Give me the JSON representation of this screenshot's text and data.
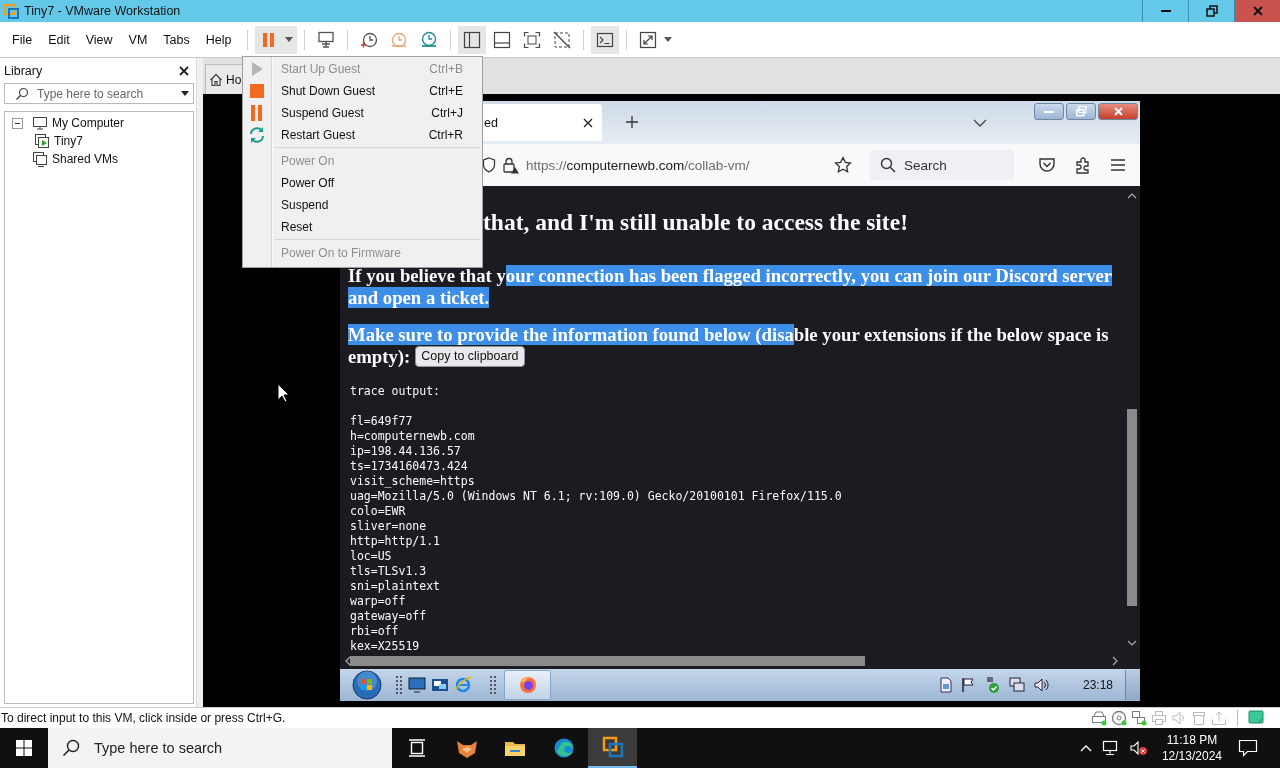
{
  "window": {
    "title": "Tiny7 - VMware Workstation"
  },
  "menu_bar": [
    "File",
    "Edit",
    "View",
    "VM",
    "Tabs",
    "Help"
  ],
  "toolbar": [
    {
      "buttons": [
        {
          "kind": "pause",
          "on": true,
          "dropdown": true
        }
      ]
    },
    {
      "buttons": [
        {
          "kind": "send-keys",
          "on": false
        }
      ]
    },
    {
      "buttons": [
        {
          "kind": "snapshot",
          "on": false
        },
        {
          "kind": "revert",
          "on": false
        },
        {
          "kind": "manager",
          "on": false
        }
      ]
    },
    {
      "buttons": [
        {
          "kind": "sidebar",
          "on": true
        },
        {
          "kind": "thumbnail",
          "on": false
        },
        {
          "kind": "fullscreen",
          "on": false
        },
        {
          "kind": "unity",
          "on": false
        }
      ]
    },
    {
      "buttons": [
        {
          "kind": "console",
          "on": true
        }
      ]
    },
    {
      "buttons": [
        {
          "kind": "stretch",
          "on": false,
          "dropdown": true
        }
      ]
    }
  ],
  "library": {
    "title": "Library",
    "search": {
      "placeholder": "Type here to search"
    },
    "tree": [
      {
        "label": "My Computer",
        "kind": "computer",
        "expanded": true,
        "children": [
          {
            "label": "Tiny7",
            "kind": "vm"
          }
        ]
      },
      {
        "label": "Shared VMs",
        "kind": "shared"
      }
    ]
  },
  "tabs": [
    {
      "label": "Ho",
      "selected": false
    }
  ],
  "vm_menu": {
    "sections": [
      {
        "items": [
          {
            "label": "Start Up Guest",
            "shortcut": "Ctrl+B",
            "kind": "play",
            "disabled": true
          },
          {
            "label": "Shut Down Guest",
            "shortcut": "Ctrl+E",
            "kind": "stop",
            "disabled": false
          },
          {
            "label": "Suspend Guest",
            "shortcut": "Ctrl+J",
            "kind": "pause",
            "disabled": false
          },
          {
            "label": "Restart Guest",
            "shortcut": "Ctrl+R",
            "kind": "restart",
            "disabled": false
          }
        ]
      },
      {
        "items": [
          {
            "label": "Power On",
            "kind": "plain",
            "disabled": true
          },
          {
            "label": "Power Off",
            "kind": "plain",
            "disabled": false
          },
          {
            "label": "Suspend",
            "kind": "plain",
            "disabled": false
          },
          {
            "label": "Reset",
            "kind": "plain",
            "disabled": false
          }
        ]
      },
      {
        "items": [
          {
            "label": "Power On to Firmware",
            "kind": "plain",
            "disabled": true
          }
        ]
      }
    ]
  },
  "browser": {
    "tab": {
      "label": "ed"
    },
    "address": {
      "scheme": "https://",
      "host": "computernewb.com",
      "path": "/collab-vm/"
    },
    "search": {
      "placeholder": "Search"
    },
    "heading": "that, and I'm still unable to access the site!",
    "paragraphs": [
      {
        "segments": [
          {
            "text": "If you believe that y",
            "selected": false
          },
          {
            "text": "our connection has been flagged incorrectly, you can join our Discord server and open a ticket.",
            "selected": true
          }
        ]
      },
      {
        "segments": [
          {
            "text": "Make sure to provide the information found below (disa",
            "selected": true
          },
          {
            "text": "ble your extensions if the below space is empty):",
            "selected": false
          }
        ],
        "button": "Copy to clipboard"
      }
    ],
    "trace": {
      "label": "trace output:",
      "lines": [
        "fl=649f77",
        "h=computernewb.com",
        "ip=198.44.136.57",
        "ts=1734160473.424",
        "visit_scheme=https",
        "uag=Mozilla/5.0 (Windows NT 6.1; rv:109.0) Gecko/20100101 Firefox/115.0",
        "colo=EWR",
        "sliver=none",
        "http=http/1.1",
        "loc=US",
        "tls=TLSv1.3",
        "sni=plaintext",
        "warp=off",
        "gateway=off",
        "rbi=off",
        "kex=X25519"
      ]
    }
  },
  "guest_taskbar": {
    "clock": "23:18"
  },
  "status_bar": {
    "message": "To direct input to this VM, click inside or press Ctrl+G."
  },
  "taskbar": {
    "search": {
      "placeholder": "Type here to search"
    },
    "apps": [
      {
        "kind": "fox",
        "selected": false
      },
      {
        "kind": "folder",
        "selected": false
      },
      {
        "kind": "edge",
        "selected": false
      },
      {
        "kind": "vmware",
        "selected": true
      }
    ],
    "time": "11:18 PM",
    "date": "12/13/2024"
  }
}
